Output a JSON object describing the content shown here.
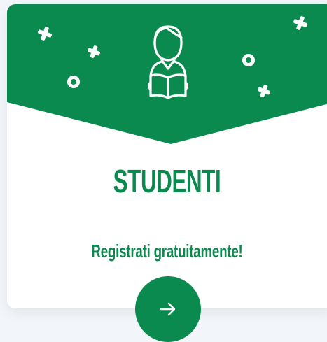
{
  "card": {
    "title": "STUDENTI",
    "subtitle": "Registrati gratuitamente!",
    "icon": "student-reading-icon",
    "action_icon": "arrow-right-icon"
  },
  "colors": {
    "brand_green": "#0b8a4f",
    "card_background": "#ffffff",
    "page_background": "#f2f5f9"
  }
}
